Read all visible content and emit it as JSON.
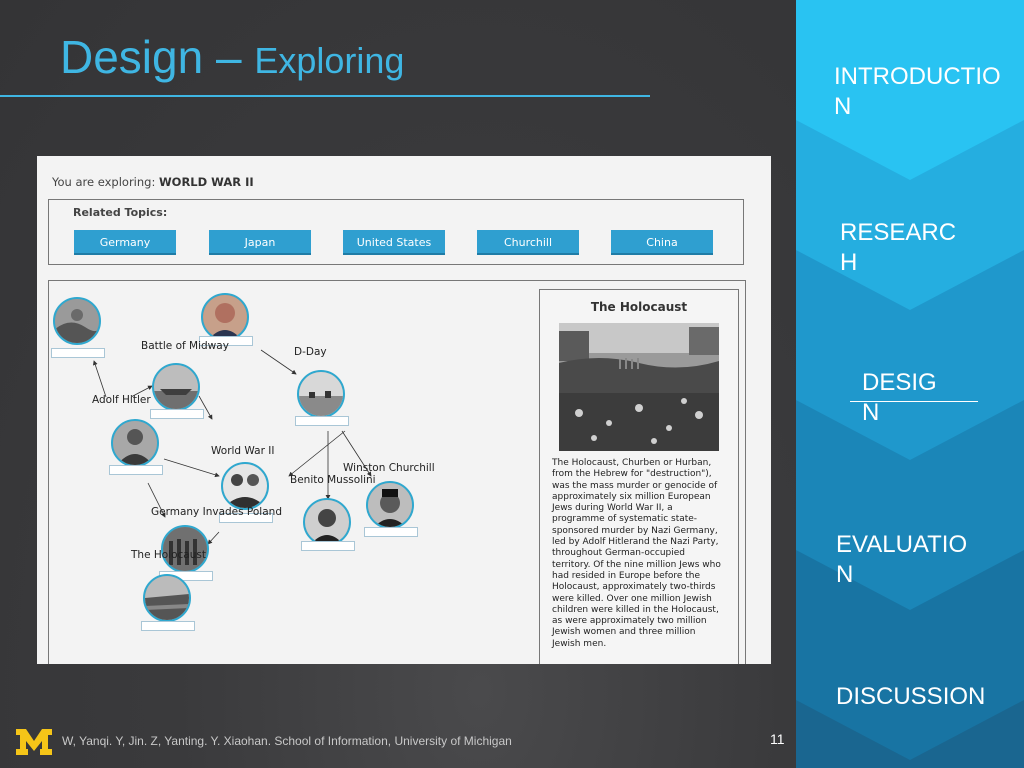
{
  "slide": {
    "title_main": "Design – ",
    "title_sub": "Exploring",
    "footer": "W, Yanqi. Y, Jin. Z, Yanting. Y. Xiaohan. School of Information, University of Michigan",
    "page_number": "11"
  },
  "nav": {
    "items": [
      {
        "label_line1": "INTRODUCTIO",
        "label_line2": "N"
      },
      {
        "label_line1": "RESEARC",
        "label_line2": "H"
      },
      {
        "label_line1": "DESIG",
        "label_line2": "N"
      },
      {
        "label_line1": "EVALUATIO",
        "label_line2": "N"
      },
      {
        "label_line1": "DISCUSSION",
        "label_line2": ""
      }
    ],
    "active": "DESIGN",
    "colors": [
      "#29c3f2",
      "#25aee0",
      "#1f98cc",
      "#1b86b8",
      "#1874a3"
    ]
  },
  "app": {
    "exploring_prefix": "You are exploring:",
    "exploring_topic": "WORLD WAR II",
    "related_label": "Related Topics:",
    "related_topics": [
      "Germany",
      "Japan",
      "United States",
      "Churchill",
      "China"
    ],
    "graph_labels": {
      "battle_of_midway": "Battle of Midway",
      "d_day": "D-Day",
      "adolf_hitler": "Adolf Hitler",
      "world_war_ii": "World War II",
      "winston_churchill": "Winston Churchill",
      "benito_mussolini": "Benito Mussolini",
      "germany_invades_poland": "Germany Invades Poland",
      "the_holocaust": "The Holocaust"
    },
    "detail": {
      "title": "The Holocaust",
      "lines": [
        "The Holocaust, Churben or Hurban,",
        "from the Hebrew for \"destruction\"),",
        "was the mass murder or genocide of",
        "approximately six million European",
        "Jews during World War II, a",
        "programme of systematic state-",
        "sponsored murder by Nazi Germany,",
        "led by Adolf Hitlerand the Nazi Party,",
        "throughout German-occupied",
        "territory. Of the nine million Jews who",
        "had resided in Europe before the",
        "Holocaust, approximately two-thirds",
        "were killed. Over one million Jewish",
        "children were killed in the Holocaust,",
        "as were approximately two million",
        "Jewish women and three million",
        "Jewish men."
      ]
    }
  },
  "colors": {
    "accent": "#3fb6e3",
    "button": "#2f9fd0",
    "node_border": "#2fa8cf"
  },
  "icons": {
    "logo": "university-of-michigan-block-m"
  }
}
